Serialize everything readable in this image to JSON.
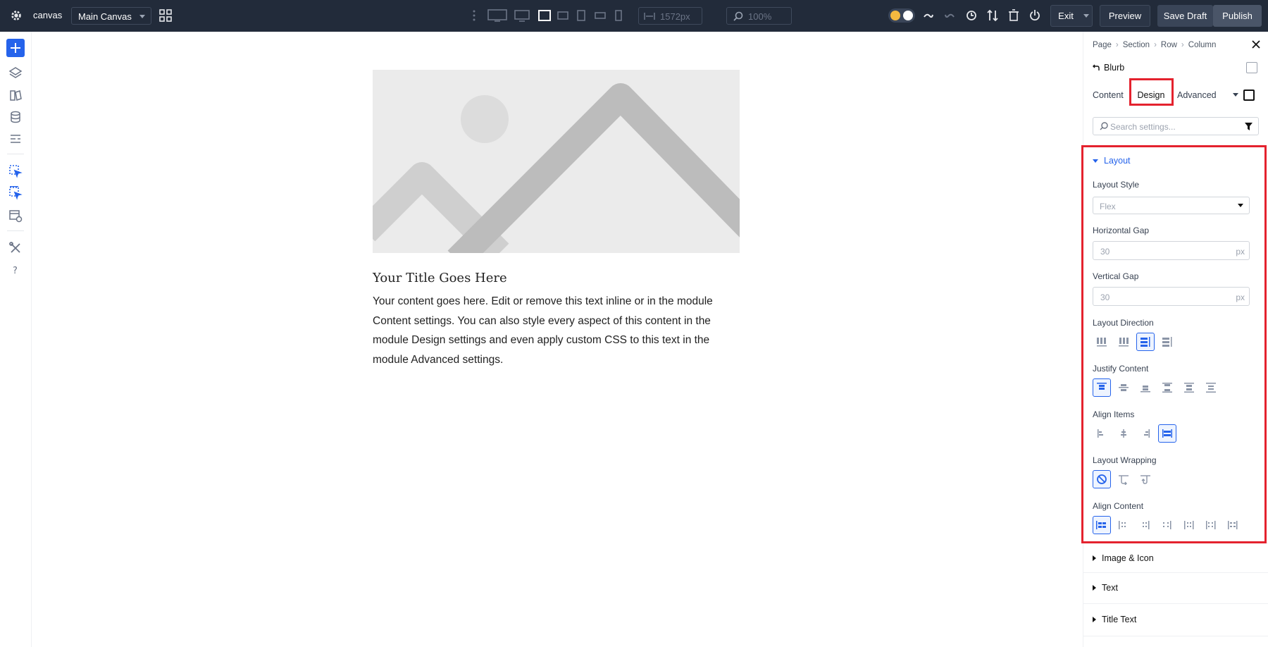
{
  "topbar": {
    "app_name": "canvas",
    "canvas_select": "Main Canvas",
    "width_value": "1572px",
    "zoom_value": "100%",
    "exit_label": "Exit",
    "preview_label": "Preview",
    "save_draft_label": "Save Draft",
    "publish_label": "Publish"
  },
  "canvas": {
    "blurb_title": "Your Title Goes Here",
    "blurb_body": "Your content goes here. Edit or remove this text inline or in the module Content settings. You can also style every aspect of this content in the module Design settings and even apply custom CSS to this text in the module Advanced settings."
  },
  "panel": {
    "breadcrumb": [
      "Page",
      "Section",
      "Row",
      "Column"
    ],
    "module_title": "Blurb",
    "tabs": {
      "content": "Content",
      "design": "Design",
      "advanced": "Advanced"
    },
    "search_placeholder": "Search settings...",
    "layout": {
      "heading": "Layout",
      "layout_style_label": "Layout Style",
      "layout_style_value": "Flex",
      "horizontal_gap_label": "Horizontal Gap",
      "horizontal_gap_value": "30",
      "vertical_gap_label": "Vertical Gap",
      "vertical_gap_value": "30",
      "unit": "px",
      "layout_direction_label": "Layout Direction",
      "justify_content_label": "Justify Content",
      "align_items_label": "Align Items",
      "layout_wrapping_label": "Layout Wrapping",
      "align_content_label": "Align Content"
    },
    "collapsed_sections": [
      "Image & Icon",
      "Text",
      "Title Text"
    ]
  },
  "colors": {
    "accent": "#2563eb",
    "topbar": "#222b3a",
    "highlight": "#e4222e"
  }
}
